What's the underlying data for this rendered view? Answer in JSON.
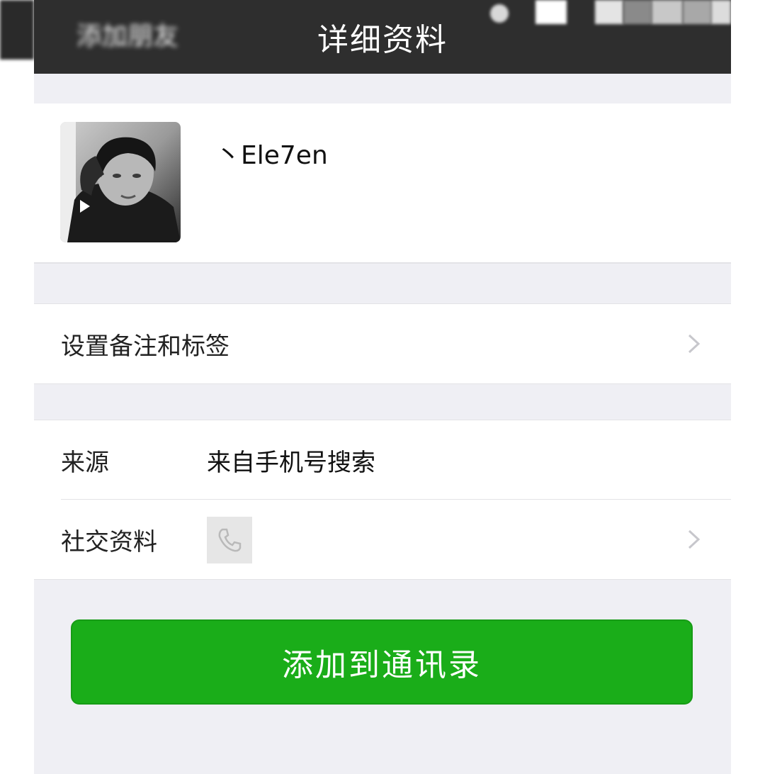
{
  "navbar": {
    "back_label": "添加朋友",
    "title": "详细资料"
  },
  "profile": {
    "nickname": "丶Ele7en"
  },
  "menu": {
    "remark_tags_label": "设置备注和标签"
  },
  "info": {
    "source_label": "来源",
    "source_value": "来自手机号搜索",
    "social_label": "社交资料"
  },
  "actions": {
    "add_button_label": "添加到通讯录"
  },
  "colors": {
    "navbar_bg": "#2e2e2e",
    "page_bg": "#efeff4",
    "accent_green": "#1aad19"
  },
  "icons": {
    "back": "blurred-back-link",
    "chevron": "chevron-right-icon",
    "phone": "phone-icon",
    "video_badge": "play-icon"
  }
}
